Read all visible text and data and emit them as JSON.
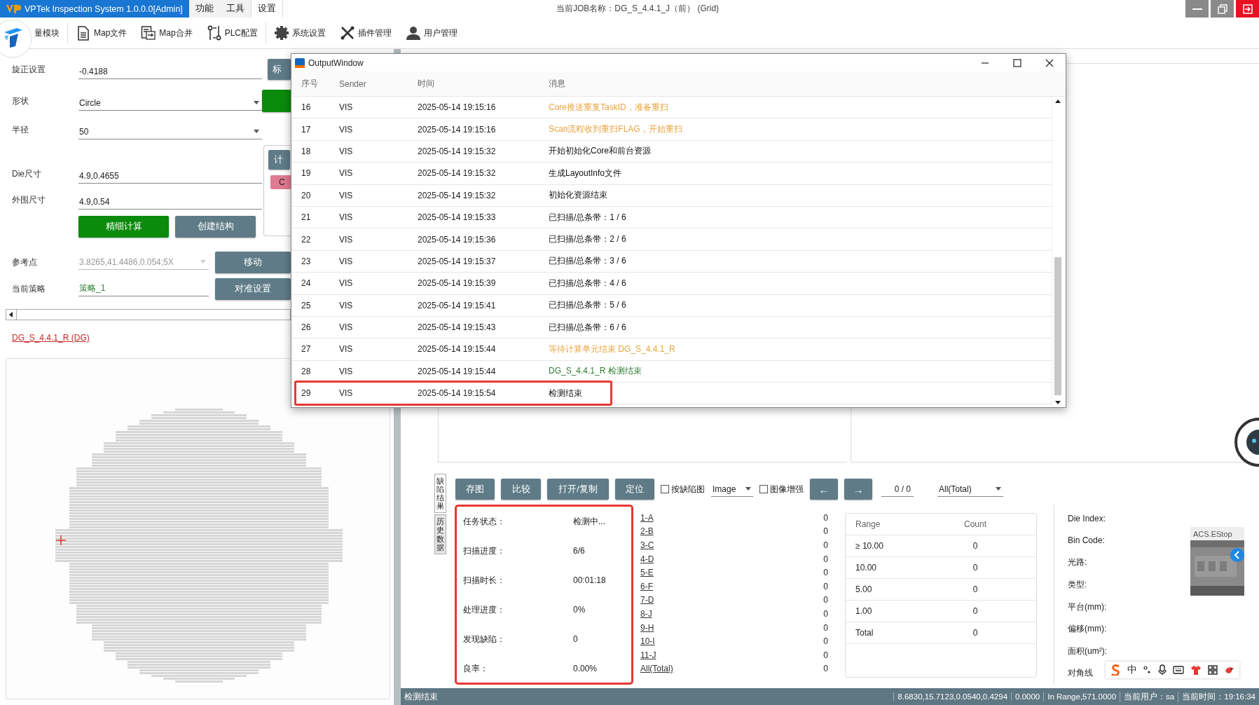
{
  "title_bar": {
    "app_title": "VPTek Inspection System 1.0.0.0[Admin]",
    "menu": [
      {
        "label": "功能",
        "selected": false
      },
      {
        "label": "工具",
        "selected": false
      },
      {
        "label": "设置",
        "selected": true
      }
    ],
    "job_label": "当前JOB名称：DG_S_4.4.1_J（前） (Grid)"
  },
  "toolbar": [
    {
      "label": "量模块"
    },
    {
      "label": "Map文件",
      "kind": "document"
    },
    {
      "label": "Map合并",
      "kind": "merge"
    },
    {
      "label": "PLC配置",
      "kind": "plc"
    },
    {
      "label": "系统设置",
      "kind": "gear"
    },
    {
      "label": "插件管理",
      "kind": "tools"
    },
    {
      "label": "用户管理",
      "kind": "user"
    }
  ],
  "left_panel": {
    "fields": [
      {
        "label": "旋正设置",
        "value": "-0.4188",
        "kind": "input"
      },
      {
        "label": "形状",
        "value": "Circle",
        "kind": "select"
      },
      {
        "label": "半径",
        "value": "50",
        "kind": "select"
      },
      {
        "label": "Die尺寸",
        "value": "4.9,0.4655",
        "kind": "input"
      },
      {
        "label": "外围尺寸",
        "value": "4.9,0.54",
        "kind": "input"
      }
    ],
    "side_button": "标",
    "calc_button": "计",
    "tag": "C",
    "calc_buttons": [
      {
        "label": "精细计算",
        "kind": "primary"
      },
      {
        "label": "创建结构",
        "kind": "secondary"
      }
    ],
    "reference": {
      "label": "参考点",
      "value": "3.8265,41.4486,0.054;5X",
      "disabled": true,
      "button": "移动"
    },
    "strategy": {
      "label": "当前策略",
      "value": "策略_1",
      "button": "对准设置"
    },
    "job_link": "DG_S_4.4.1_R (DG)"
  },
  "output_window": {
    "title": "OutputWindow",
    "columns": [
      "序号",
      "Sender",
      "时间",
      "消息"
    ],
    "rows": [
      {
        "no": "16",
        "sender": "VIS",
        "time": "2025-05-14 19:15:16",
        "message": "Core推送重复TaskID，准备重扫",
        "color": "#e8a33d",
        "highlighted": false
      },
      {
        "no": "17",
        "sender": "VIS",
        "time": "2025-05-14 19:15:16",
        "message": "Scan流程收到重扫FLAG，开始重扫",
        "color": "#e8a33d",
        "highlighted": false
      },
      {
        "no": "18",
        "sender": "VIS",
        "time": "2025-05-14 19:15:32",
        "message": "开始初始化Core和前台资源",
        "highlighted": false
      },
      {
        "no": "19",
        "sender": "VIS",
        "time": "2025-05-14 19:15:32",
        "message": "生成LayoutInfo文件",
        "highlighted": false
      },
      {
        "no": "20",
        "sender": "VIS",
        "time": "2025-05-14 19:15:32",
        "message": "初始化资源结束",
        "highlighted": false
      },
      {
        "no": "21",
        "sender": "VIS",
        "time": "2025-05-14 19:15:33",
        "message": "已扫描/总条带：1 / 6",
        "highlighted": false
      },
      {
        "no": "22",
        "sender": "VIS",
        "time": "2025-05-14 19:15:36",
        "message": "已扫描/总条带：2 / 6",
        "highlighted": false
      },
      {
        "no": "23",
        "sender": "VIS",
        "time": "2025-05-14 19:15:37",
        "message": "已扫描/总条带：3 / 6",
        "highlighted": false
      },
      {
        "no": "24",
        "sender": "VIS",
        "time": "2025-05-14 19:15:39",
        "message": "已扫描/总条带：4 / 6",
        "highlighted": false
      },
      {
        "no": "25",
        "sender": "VIS",
        "time": "2025-05-14 19:15:41",
        "message": "已扫描/总条带：5 / 6",
        "highlighted": false
      },
      {
        "no": "26",
        "sender": "VIS",
        "time": "2025-05-14 19:15:43",
        "message": "已扫描/总条带：6 / 6",
        "highlighted": false
      },
      {
        "no": "27",
        "sender": "VIS",
        "time": "2025-05-14 19:15:44",
        "message": "等待计算单元结束 DG_S_4.4.1_R",
        "color": "#e8a33d",
        "highlighted": false
      },
      {
        "no": "28",
        "sender": "VIS",
        "time": "2025-05-14 19:15:44",
        "message": "DG_S_4.4.1_R 检测结束",
        "color": "#2e7d32",
        "highlighted": false
      },
      {
        "no": "29",
        "sender": "VIS",
        "time": "2025-05-14 19:15:54",
        "message": "检测结束",
        "highlighted": true
      }
    ]
  },
  "bottom": {
    "side_tabs": [
      {
        "label": "缺陷结果",
        "selected": true
      },
      {
        "label": "历史数据",
        "selected": false
      }
    ],
    "toolbar": {
      "buttons": [
        "存图",
        "比较",
        "打开/复制",
        "定位"
      ],
      "defect_map_check": {
        "label": "按缺陷图",
        "checked": false
      },
      "image_select": "Image",
      "enhance_check": {
        "label": "图像增强",
        "checked": false
      },
      "prev": "←",
      "next": "→",
      "page": "0 / 0",
      "filter": "All(Total)"
    },
    "status_panel": {
      "highlighted": true,
      "rows": [
        {
          "label": "任务状态：",
          "value": "检测中..."
        },
        {
          "label": "扫描进度：",
          "value": "6/6"
        },
        {
          "label": "扫描时长：",
          "value": "00:01:18"
        },
        {
          "label": "处理进度：",
          "value": "0%"
        },
        {
          "label": "发现缺陷：",
          "value": "0"
        },
        {
          "label": "良率：",
          "value": "0.00%"
        }
      ]
    },
    "defect_classes": [
      {
        "name": "1-A",
        "count": "0"
      },
      {
        "name": "2-B",
        "count": "0"
      },
      {
        "name": "3-C",
        "count": "0"
      },
      {
        "name": "4-D",
        "count": "0"
      },
      {
        "name": "5-E",
        "count": "0"
      },
      {
        "name": "6-F",
        "count": "0"
      },
      {
        "name": "7-D",
        "count": "0"
      },
      {
        "name": "8-J",
        "count": "0"
      },
      {
        "name": "9-H",
        "count": "0"
      },
      {
        "name": "10-I",
        "count": "0"
      },
      {
        "name": "11-J",
        "count": "0"
      },
      {
        "name": "All(Total)",
        "count": "0"
      }
    ],
    "range_table": {
      "columns": [
        "Range",
        "Count"
      ],
      "rows": [
        [
          "≥ 10.00",
          "0"
        ],
        [
          "10.00",
          "0"
        ],
        [
          "5.00",
          "0"
        ],
        [
          "1.00",
          "0"
        ],
        [
          "Total",
          "0"
        ]
      ]
    },
    "info_labels": [
      "Die Index:",
      "Bin Code:",
      "光路:",
      "类型:",
      "平台(mm):",
      "偏移(mm):",
      "面积(um²):",
      "对角线"
    ],
    "thumbnail": {
      "title": "ACS.EStop",
      "kind": "picture"
    }
  },
  "ime_bar": {
    "mode": "中"
  },
  "status_bar": {
    "message": "检测结束",
    "fields": [
      "8.6830,15.7123,0.0540,0.4294",
      "0.0000",
      "In Range,571.0000",
      "当前用户：sa",
      "当前时间：19:16:34"
    ]
  }
}
